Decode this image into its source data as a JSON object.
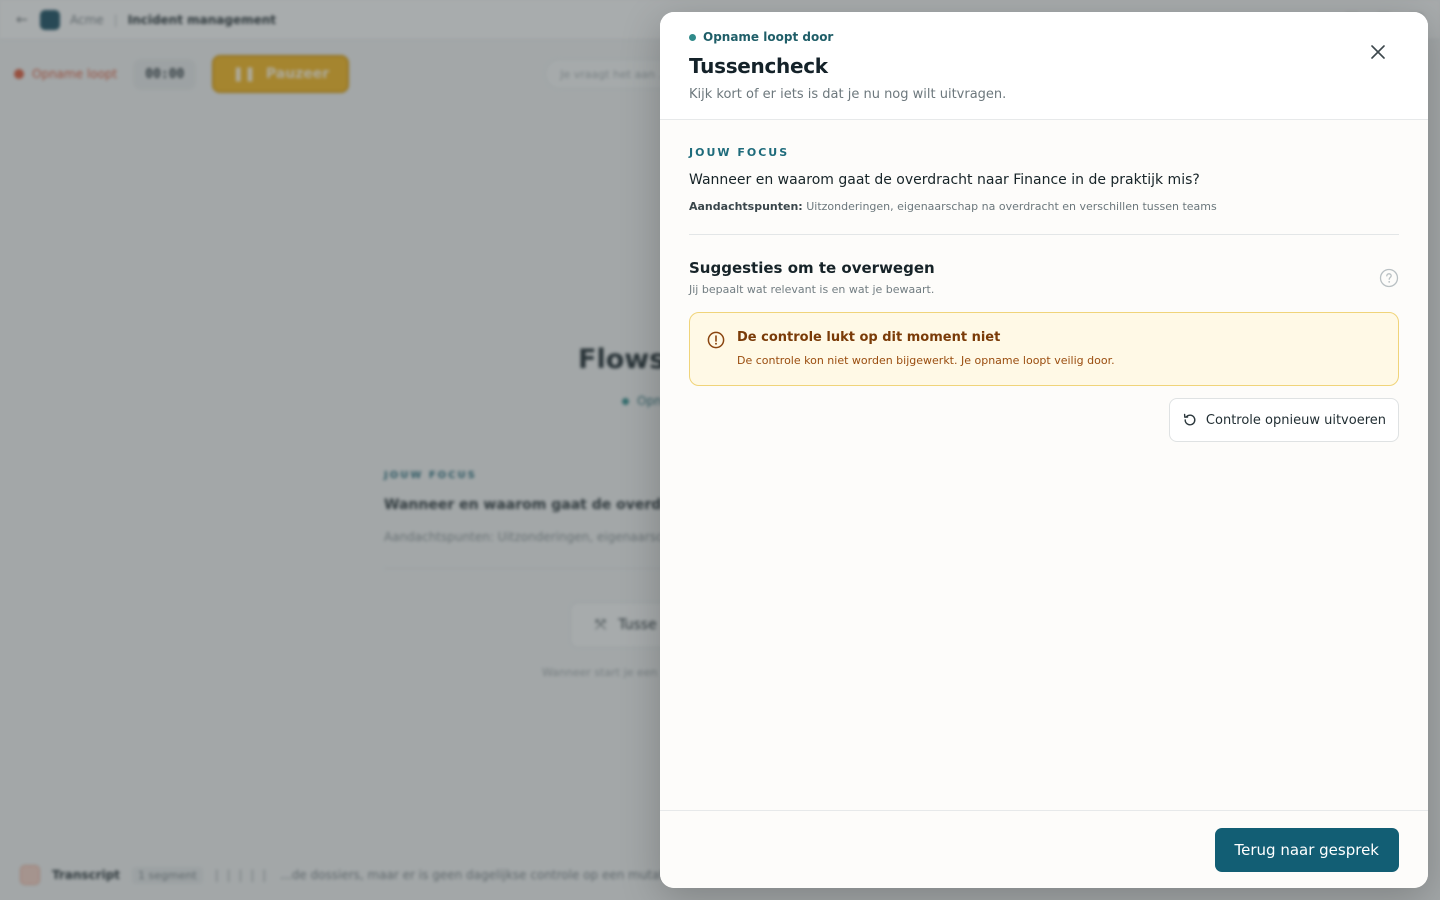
{
  "background": {
    "org_name": "Acme",
    "page_title": "Incident management",
    "recording_label": "Opname loopt",
    "timer": "00:00",
    "pause_label": "Pauzeer",
    "search_placeholder": "Je vraagt het aan ...",
    "session_title": "Flowst",
    "status_label": "Opn",
    "focus_heading": "JOUW FOCUS",
    "focus_question": "Wanneer en waarom gaat de overdracht",
    "focus_attention": "Aandachtspunten: Uitzonderingen, eigenaarsc",
    "tussencheck_button": "Tusse",
    "hint_text": "Wanneer start je een",
    "footer": {
      "transcript_label": "Transcript",
      "segment_badge": "1 segment",
      "bars": "| | | | |",
      "snippet": "...de dossiers, maar er is geen dagelijkse controle op een mutatie gebe"
    }
  },
  "panel": {
    "status": "Opname loopt door",
    "title": "Tussencheck",
    "subtitle": "Kijk kort of er iets is dat je nu nog wilt uitvragen.",
    "focus": {
      "heading": "JOUW FOCUS",
      "question": "Wanneer en waarom gaat de overdracht naar Finance in de praktijk mis?",
      "attention_label": "Aandachtspunten:",
      "attention_text": "Uitzonderingen, eigenaarschap na overdracht en verschillen tussen teams"
    },
    "suggestions": {
      "title": "Suggesties om te overwegen",
      "subtitle": "Jij bepaalt wat relevant is en wat je bewaart."
    },
    "alert": {
      "title": "De controle lukt op dit moment niet",
      "text": "De controle kon niet worden bijgewerkt. Je opname loopt veilig door."
    },
    "retry_button": "Controle opnieuw uitvoeren",
    "primary_button": "Terug naar gesprek"
  },
  "colors": {
    "accent": "#125e74",
    "status_dot": "#2f8a8a",
    "alert_bg": "#fff9e6",
    "alert_border": "#f0d47a",
    "alert_text": "#7a3b08"
  },
  "icons": {
    "close": "close-icon",
    "help": "help-circle-icon",
    "alert": "alert-circle-icon",
    "retry": "refresh-icon"
  }
}
